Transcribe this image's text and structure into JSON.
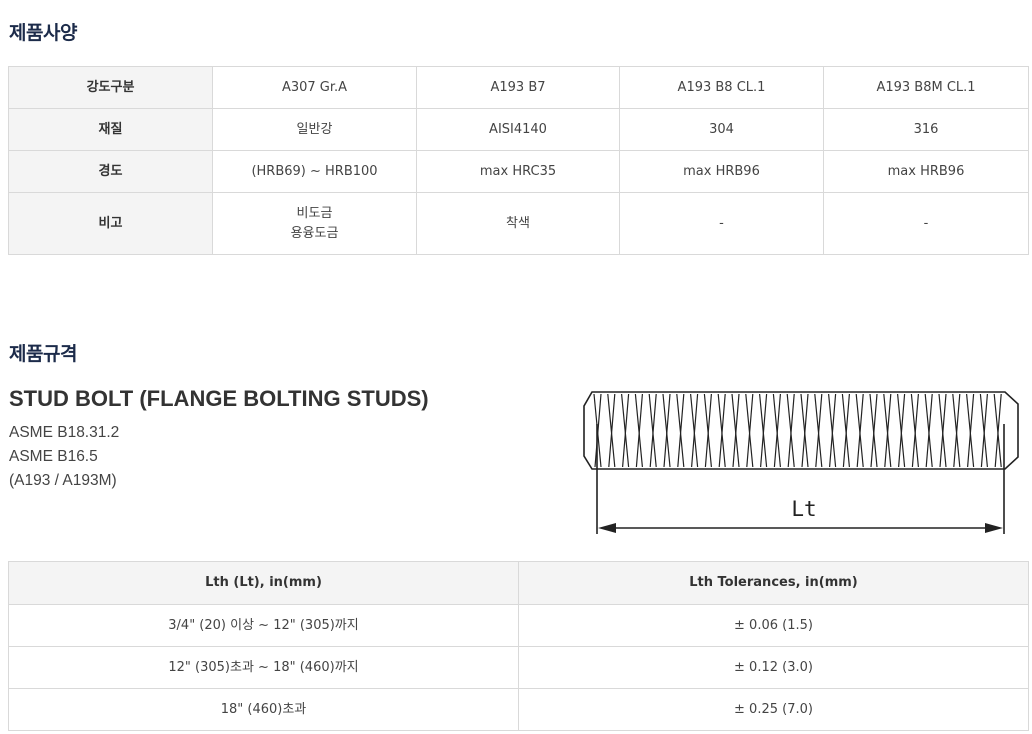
{
  "spec_section": {
    "title": "제품사양",
    "row_headers": [
      "강도구분",
      "재질",
      "경도",
      "비고"
    ],
    "columns": [
      "A307 Gr.A",
      "A193 B7",
      "A193 B8 CL.1",
      "A193 B8M CL.1"
    ],
    "material": [
      "일반강",
      "AISI4140",
      "304",
      "316"
    ],
    "hardness": [
      "(HRB69) ~ HRB100",
      "max HRC35",
      "max HRB96",
      "max HRB96"
    ],
    "notes": [
      {
        "line1": "비도금",
        "line2": "용융도금"
      },
      {
        "line1": "착색",
        "line2": ""
      },
      {
        "line1": "-",
        "line2": ""
      },
      {
        "line1": "-",
        "line2": ""
      }
    ]
  },
  "standard_section": {
    "title": "제품규격",
    "product_title": "STUD BOLT (FLANGE BOLTING STUDS)",
    "standards": [
      "ASME B18.31.2",
      "ASME B16.5",
      "(A193 / A193M)"
    ],
    "diagram": {
      "length_label": "Lt",
      "icon": "stud-bolt-drawing"
    }
  },
  "dims_table": {
    "headers": [
      "Lth (Lt), in(mm)",
      "Lth Tolerances, in(mm)"
    ],
    "rows": [
      [
        "3/4\" (20) 이상 ~ 12\" (305)까지",
        "± 0.06 (1.5)"
      ],
      [
        "12\" (305)초과 ~ 18\" (460)까지",
        "± 0.12 (3.0)"
      ],
      [
        "18\" (460)초과",
        "± 0.25 (7.0)"
      ]
    ]
  },
  "colors": {
    "title": "#1c2b4a",
    "header_bg": "#f4f4f4",
    "border": "#d9d9d9"
  }
}
